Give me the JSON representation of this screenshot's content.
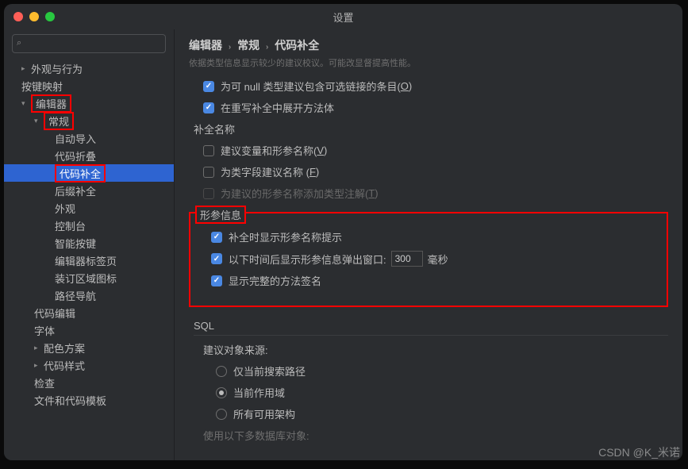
{
  "title": "设置",
  "search_placeholder": "",
  "breadcrumb": [
    "编辑器",
    "常规",
    "代码补全"
  ],
  "hint": "依据类型信息显示较少的建议校议。可能改显督提高性能。",
  "sidebar": [
    {
      "label": "外观与行为",
      "lvl": 1,
      "chev": "right"
    },
    {
      "label": "按键映射",
      "lvl": 1
    },
    {
      "label": "编辑器",
      "lvl": 1,
      "chev": "down",
      "red": true
    },
    {
      "label": "常规",
      "lvl": 2,
      "chev": "down",
      "red": true
    },
    {
      "label": "自动导入",
      "lvl": 3
    },
    {
      "label": "代码折叠",
      "lvl": 3
    },
    {
      "label": "代码补全",
      "lvl": 3,
      "active": true,
      "red": true
    },
    {
      "label": "后缀补全",
      "lvl": 3
    },
    {
      "label": "外观",
      "lvl": 3
    },
    {
      "label": "控制台",
      "lvl": 3
    },
    {
      "label": "智能按键",
      "lvl": 3
    },
    {
      "label": "编辑器标签页",
      "lvl": 3
    },
    {
      "label": "装订区域图标",
      "lvl": 3
    },
    {
      "label": "路径导航",
      "lvl": 3
    },
    {
      "label": "代码编辑",
      "lvl": 2
    },
    {
      "label": "字体",
      "lvl": 2
    },
    {
      "label": "配色方案",
      "lvl": 2,
      "chev": "right"
    },
    {
      "label": "代码样式",
      "lvl": 2,
      "chev": "right"
    },
    {
      "label": "检查",
      "lvl": 2
    },
    {
      "label": "文件和代码模板",
      "lvl": 2
    }
  ],
  "opts": {
    "nullable": {
      "checked": true,
      "text": "为可 null 类型建议包含可选链接的条目(",
      "key": "O",
      "tail": ")"
    },
    "override": {
      "checked": true,
      "text": "在重写补全中展开方法体"
    },
    "group_name": "补全名称",
    "var_param": {
      "checked": false,
      "text": "建议变量和形参名称(",
      "key": "V",
      "tail": ")"
    },
    "class_field": {
      "checked": false,
      "text": "为类字段建议名称 (",
      "key": "F",
      "tail": ")"
    },
    "type_ann": {
      "checked": false,
      "disabled": true,
      "text": "为建议的形参名称添加类型注解(",
      "key": "T",
      "tail": ")"
    }
  },
  "param_info": {
    "legend": "形参信息",
    "hint_on_complete": {
      "checked": true,
      "text": "补全时显示形参名称提示"
    },
    "popup_delay": {
      "checked": true,
      "prefix": "以下时间后显示形参信息弹出窗口:",
      "value": "300",
      "suffix": "毫秒"
    },
    "full_sig": {
      "checked": true,
      "text": "显示完整的方法签名"
    }
  },
  "sql": {
    "title": "SQL",
    "source_label": "建议对象来源:",
    "opts": [
      {
        "label": "仅当前搜索路径",
        "checked": false
      },
      {
        "label": "当前作用域",
        "checked": true
      },
      {
        "label": "所有可用架构",
        "checked": false
      }
    ]
  },
  "footer_partial": "使用以下多数据库对象:",
  "watermark": "CSDN @K_米诺"
}
